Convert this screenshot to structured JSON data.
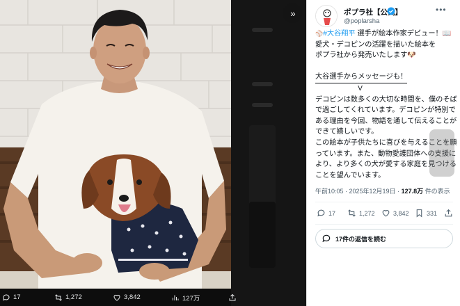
{
  "viewer": {
    "expand_icon": "»",
    "replies": "17",
    "reposts": "1,272",
    "likes": "3,842",
    "views": "127万"
  },
  "account": {
    "name": "ポプラ社【公式】",
    "handle": "@poplarsha"
  },
  "tweet": {
    "lines": [
      {
        "hashtag": "#大谷翔平",
        "text": " 選手が絵本作家デビュー！📖"
      },
      {
        "text": "愛犬・デコピンの活躍を描いた絵本を"
      },
      {
        "text": "ポプラ社から発売いたします🐶"
      },
      {
        "text": ""
      },
      {
        "text": "大谷選手からメッセージも！"
      },
      {
        "text": "　　　　　　V"
      },
      {
        "text": "デコピンは数多くの大切な時間を、僕のそば"
      },
      {
        "text": "で過ごしてくれています。デコピンが特別で"
      },
      {
        "text": "ある理由を今回、物語を通して伝えることが"
      },
      {
        "text": "できて嬉しいです。"
      },
      {
        "text": "この絵本が子供たちに喜びを与えることを願"
      },
      {
        "text": "っています。また、動物愛護団体への支援に"
      },
      {
        "text": "より、より多くの犬が愛する家庭を見つける"
      },
      {
        "text": "ことを望んでいます。"
      }
    ],
    "time": "午前10:05 · 2025年12月19日 · ",
    "views_count": "127.8万",
    "views_label": " 件の表示"
  },
  "actions": {
    "replies": "17",
    "reposts": "1,272",
    "likes": "3,842",
    "bookmarks": "331"
  },
  "reply_button": {
    "label": "17件の返信を読む"
  },
  "colors": {
    "accent": "#1d9bf0",
    "text": "#0f1419",
    "muted": "#536471"
  }
}
